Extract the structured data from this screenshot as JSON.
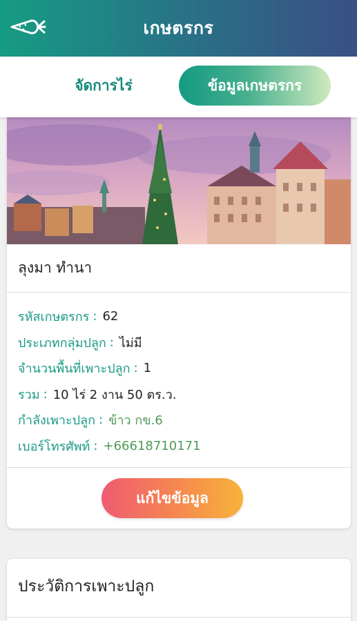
{
  "header": {
    "title": "เกษตรกร",
    "menu_icon": "carrot-icon"
  },
  "tabs": [
    {
      "label": "จัดการไร่",
      "active": false
    },
    {
      "label": "ข้อมูลเกษตรกร",
      "active": true
    }
  ],
  "profile": {
    "name": "ลุงมา ทำนา",
    "fields": [
      {
        "label": "รหัสเกษตรกร",
        "value": "62"
      },
      {
        "label": "ประเภทกลุ่มปลูก",
        "value": "ไม่มี"
      },
      {
        "label": "จำนวนพื้นที่เพาะปลูก",
        "value": "1"
      },
      {
        "label": "รวม",
        "value": "10 ไร่ 2 งาน 50 ตร.ว."
      },
      {
        "label": "กำลังเพาะปลูก",
        "value": "ข้าว กข.6"
      },
      {
        "label": "เบอร์โทรศัพท์",
        "value": "+66618710171"
      }
    ],
    "edit_label": "แก้ไขข้อมูล"
  },
  "history": {
    "title": "ประวัติการเพาะปลูก"
  },
  "colors": {
    "accent": "#1a9a86",
    "header_start": "#169c84",
    "header_end": "#3a4f86",
    "edit_start": "#f05a72",
    "edit_end": "#f7b23a"
  }
}
